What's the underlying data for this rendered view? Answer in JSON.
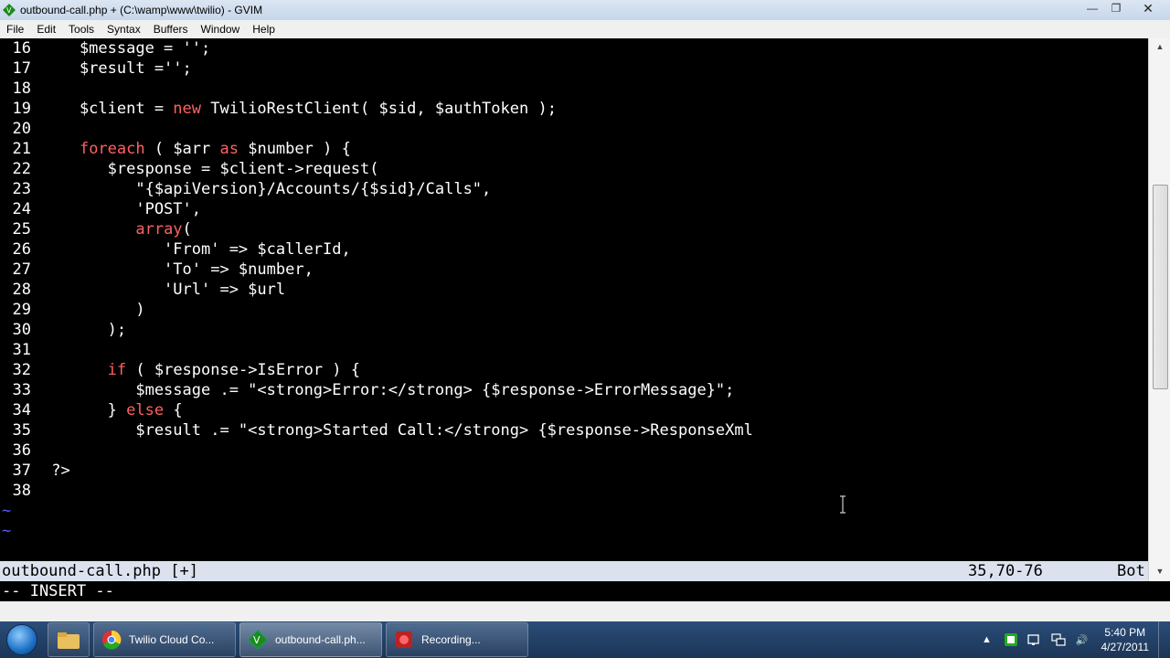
{
  "window": {
    "title": "outbound-call.php + (C:\\wamp\\www\\twilio) - GVIM",
    "minimize_symbol": "—",
    "maximize_symbol": "❐",
    "close_symbol": "✕"
  },
  "menu": [
    "File",
    "Edit",
    "Tools",
    "Syntax",
    "Buffers",
    "Window",
    "Help"
  ],
  "editor": {
    "lines": [
      {
        "num": "16",
        "text": "    $message = '';"
      },
      {
        "num": "17",
        "text": "    $result ='';"
      },
      {
        "num": "18",
        "text": ""
      },
      {
        "num": "19",
        "text": "    $client = new TwilioRestClient( $sid, $authToken );"
      },
      {
        "num": "20",
        "text": ""
      },
      {
        "num": "21",
        "text": "    foreach ( $arr as $number ) {"
      },
      {
        "num": "22",
        "text": "       $response = $client->request("
      },
      {
        "num": "23",
        "text": "          \"{$apiVersion}/Accounts/{$sid}/Calls\","
      },
      {
        "num": "24",
        "text": "          'POST',"
      },
      {
        "num": "25",
        "text": "          array("
      },
      {
        "num": "26",
        "text": "             'From' => $callerId,"
      },
      {
        "num": "27",
        "text": "             'To' => $number,"
      },
      {
        "num": "28",
        "text": "             'Url' => $url"
      },
      {
        "num": "29",
        "text": "          )"
      },
      {
        "num": "30",
        "text": "       );"
      },
      {
        "num": "31",
        "text": ""
      },
      {
        "num": "32",
        "text": "       if ( $response->IsError ) {"
      },
      {
        "num": "33",
        "text": "          $message .= \"<strong>Error:</strong> {$response->ErrorMessage}\";"
      },
      {
        "num": "34",
        "text": "       } else {"
      },
      {
        "num": "35",
        "text": "          $result .= \"<strong>Started Call:</strong> {$response->ResponseXml"
      },
      {
        "num": "36",
        "text": ""
      },
      {
        "num": "37",
        "text": " ?>"
      },
      {
        "num": "38",
        "text": ""
      }
    ],
    "tilde_lines": [
      "~",
      "~"
    ]
  },
  "statusline": {
    "filename": "outbound-call.php [+]",
    "position": "35,70-76",
    "scroll": "Bot"
  },
  "mode": "-- INSERT --",
  "taskbar": {
    "items": [
      {
        "label": "",
        "icon": "folder-icon"
      },
      {
        "label": "Twilio Cloud Co...",
        "icon": "chrome-icon"
      },
      {
        "label": "outbound-call.ph...",
        "icon": "vim-icon",
        "active": true
      },
      {
        "label": "Recording...",
        "icon": "recorder-icon"
      }
    ],
    "clock_time": "5:40 PM",
    "clock_date": "4/27/2011",
    "tray_arrow": "▲",
    "speaker_symbol": "🔊"
  },
  "colors": {
    "editor_bg": "#000000",
    "statusline_bg": "#dbe2ee",
    "keyword": "#ff6161",
    "tilde": "#5a5aff"
  }
}
